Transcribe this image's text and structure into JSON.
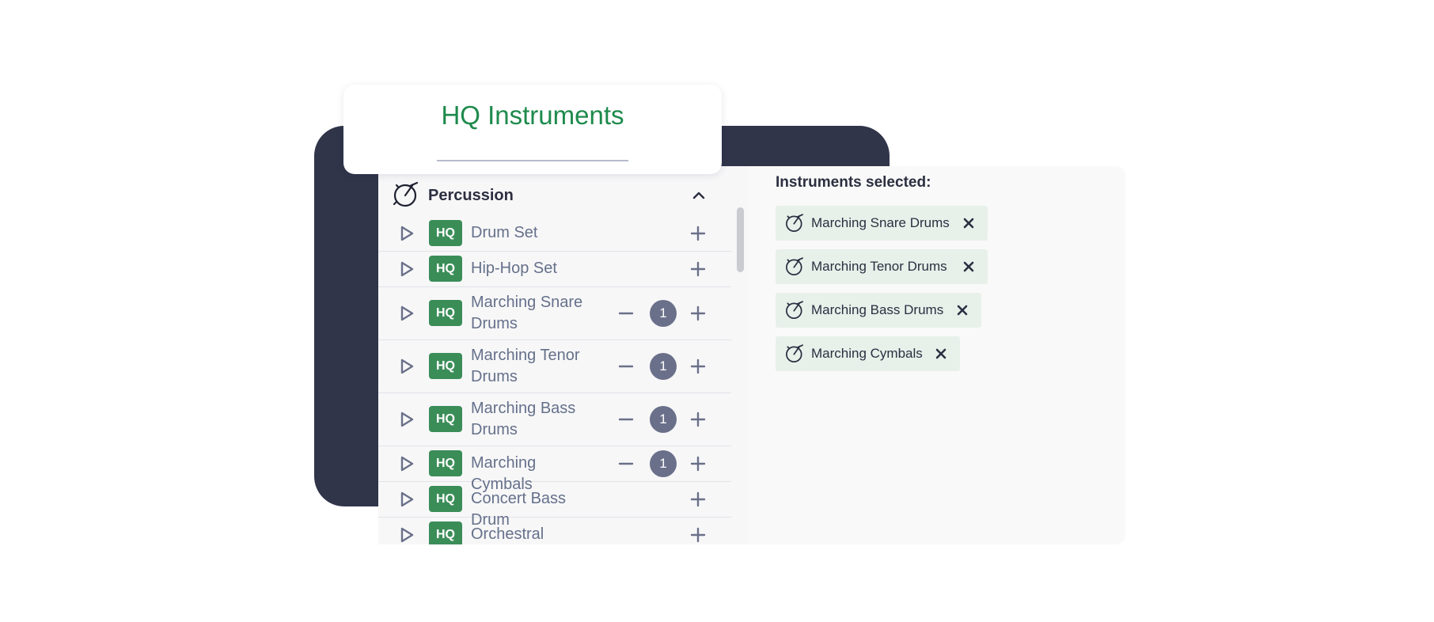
{
  "title": "HQ Instruments",
  "colors": {
    "accent_green": "#1e8a4c",
    "hq_badge": "#3b8d58",
    "dark_panel": "#30354a",
    "count_badge": "#6a7089",
    "chip_background": "#e8f0ea"
  },
  "category": {
    "label": "Percussion",
    "icon": "drum-icon",
    "expanded": true
  },
  "instruments": [
    {
      "badge": "HQ",
      "name": "Drum Set",
      "count": null
    },
    {
      "badge": "HQ",
      "name": "Hip-Hop Set",
      "count": null
    },
    {
      "badge": "HQ",
      "name": "Marching Snare Drums",
      "count": "1"
    },
    {
      "badge": "HQ",
      "name": "Marching Tenor Drums",
      "count": "1"
    },
    {
      "badge": "HQ",
      "name": "Marching Bass Drums",
      "count": "1"
    },
    {
      "badge": "HQ",
      "name": "Marching Cymbals",
      "count": "1"
    },
    {
      "badge": "HQ",
      "name": "Concert Bass Drum",
      "count": null
    },
    {
      "badge": "HQ",
      "name": "Orchestral Cymbals",
      "count": null
    }
  ],
  "selected": {
    "heading": "Instruments selected:",
    "items": [
      {
        "label": "Marching Snare Drums",
        "icon": "drum-icon"
      },
      {
        "label": "Marching Tenor Drums",
        "icon": "drum-icon"
      },
      {
        "label": "Marching Bass Drums",
        "icon": "drum-icon"
      },
      {
        "label": "Marching Cymbals",
        "icon": "drum-icon"
      }
    ]
  }
}
